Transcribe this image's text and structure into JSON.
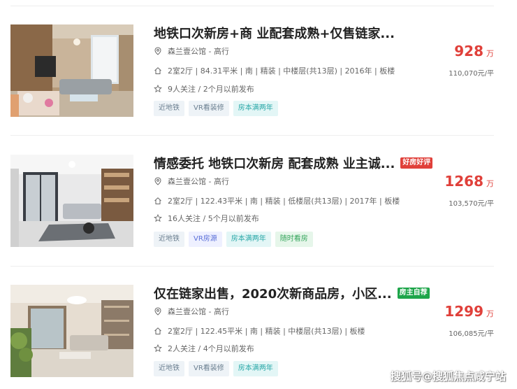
{
  "listings": [
    {
      "title": "地铁口次新房+商 业配套成熟+仅售链家...",
      "badge": "",
      "community": "森兰壹公馆 - 高行",
      "info": "2室2厅 | 84.31平米 | 南 | 精装 | 中楼层(共13层) | 2016年 | 板楼",
      "follow": "9人关注 / 2个月以前发布",
      "tags": [
        "近地铁",
        "VR看装修",
        "房本满两年"
      ],
      "price": "928",
      "price_unit": "万",
      "unit_price": "110,070元/平"
    },
    {
      "title": "情感委托 地铁口次新房 配套成熟 业主诚...",
      "badge": "好房好评",
      "community": "森兰壹公馆 - 高行",
      "info": "2室2厅 | 122.43平米 | 南 | 精装 | 低楼层(共13层) | 2017年 | 板楼",
      "follow": "16人关注 / 5个月以前发布",
      "tags": [
        "近地铁",
        "VR房源",
        "房本满两年",
        "随时看房"
      ],
      "price": "1268",
      "price_unit": "万",
      "unit_price": "103,570元/平"
    },
    {
      "title": "仅在链家出售，2020次新商品房，小区...",
      "badge": "房主自荐",
      "community": "森兰壹公馆 - 高行",
      "info": "2室2厅 | 122.45平米 | 南 | 精装 | 中楼层(共13层) | 板楼",
      "follow": "2人关注 / 4个月以前发布",
      "tags": [
        "近地铁",
        "VR看装修",
        "房本满两年"
      ],
      "price": "1299",
      "price_unit": "万",
      "unit_price": "106,085元/平"
    }
  ],
  "watermark": "搜狐号@搜狐焦点咸宁站",
  "colors": {
    "price": "#e0403a",
    "badge_red": "#e0403a",
    "badge_green": "#1ea54a"
  }
}
